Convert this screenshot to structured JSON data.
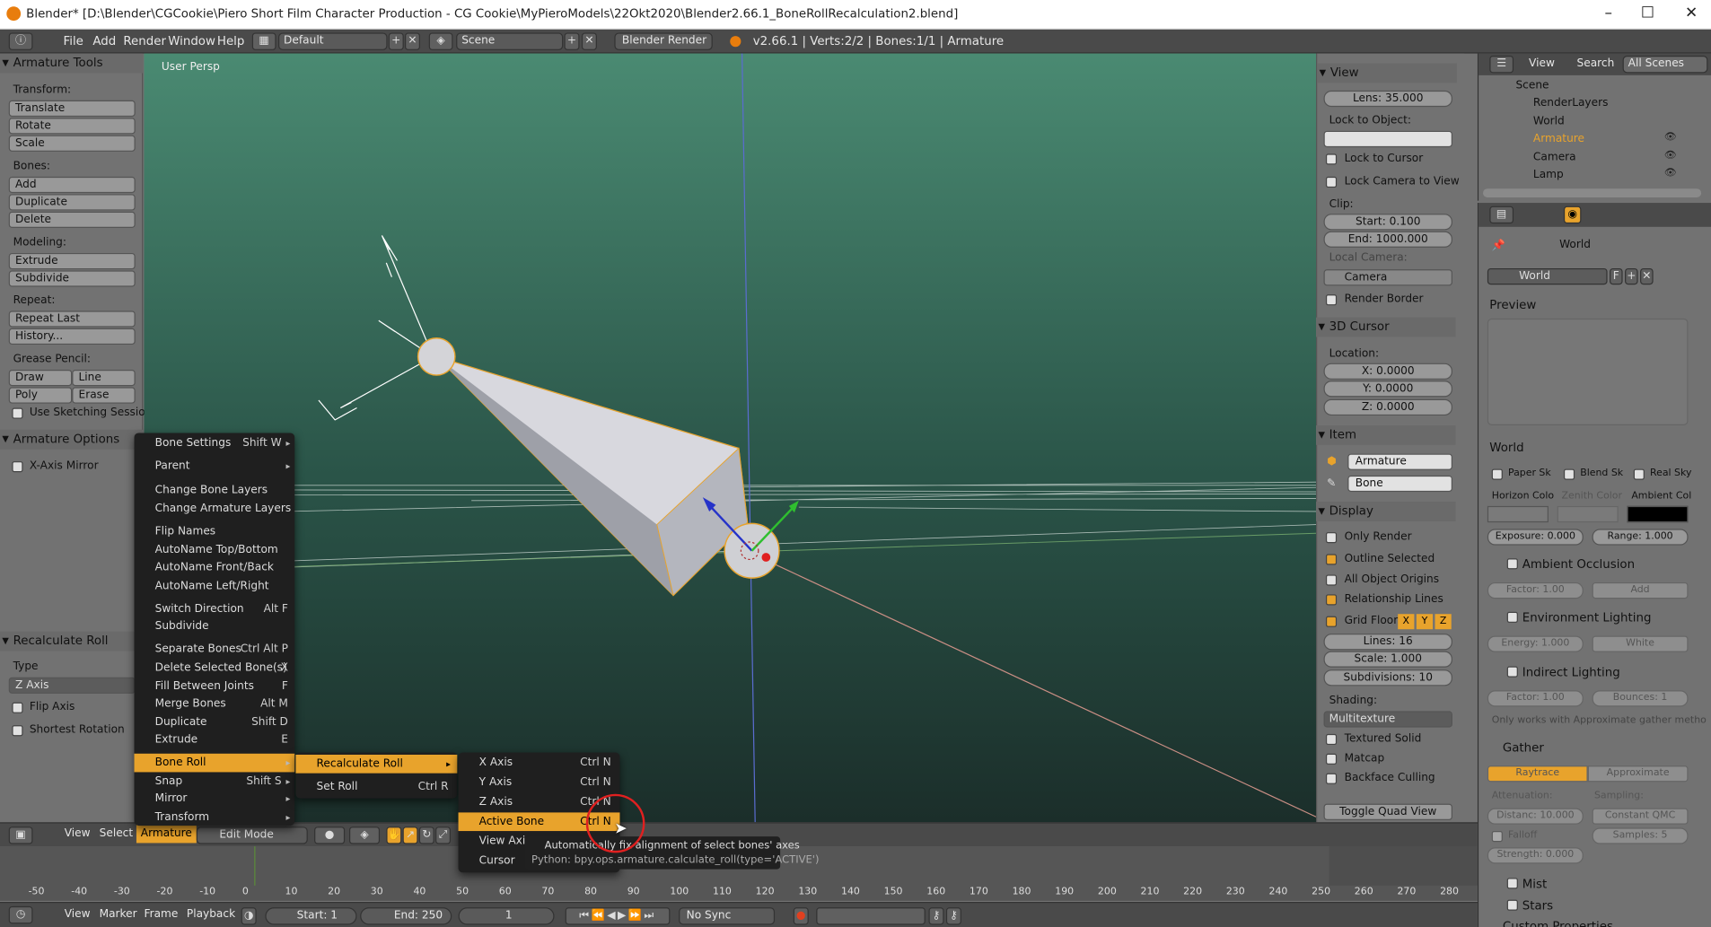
{
  "window": {
    "title": "Blender* [D:\\Blender\\CGCookie\\Piero Short Film Character Production - CG Cookie\\MyPieroModels\\22Okt2020\\Blender2.66.1_BoneRollRecalculation2.blend]",
    "min": "–",
    "max": "☐",
    "close": "✕"
  },
  "menubar": {
    "file": "File",
    "add": "Add",
    "render": "Render",
    "window": "Window",
    "help": "Help",
    "layout": "Default",
    "scene": "Scene",
    "engine": "Blender Render",
    "stats": "v2.66.1 | Verts:2/2 | Bones:1/1 | Armature"
  },
  "toolshelf": {
    "title": "Armature Tools",
    "transform_label": "Transform:",
    "translate": "Translate",
    "rotate": "Rotate",
    "scale": "Scale",
    "bones_label": "Bones:",
    "add": "Add",
    "duplicate": "Duplicate",
    "delete": "Delete",
    "modeling_label": "Modeling:",
    "extrude": "Extrude",
    "subdivide": "Subdivide",
    "repeat_label": "Repeat:",
    "repeat_last": "Repeat Last",
    "history": "History...",
    "grease_label": "Grease Pencil:",
    "draw": "Draw",
    "line": "Line",
    "poly": "Poly",
    "erase": "Erase",
    "sketching": "Use Sketching Sessions",
    "options_title": "Armature Options",
    "xmirror": "X-Axis Mirror",
    "recalc_title": "Recalculate Roll",
    "type_label": "Type",
    "type_value": "Z Axis",
    "flip_axis": "Flip Axis",
    "shortest_rotation": "Shortest Rotation"
  },
  "viewport": {
    "label": "User Persp"
  },
  "npanel": {
    "view_title": "View",
    "lens": "Lens: 35.000",
    "lock_object": "Lock to Object:",
    "lock_cursor": "Lock to Cursor",
    "lock_camera": "Lock Camera to View",
    "clip": "Clip:",
    "clip_start": "Start: 0.100",
    "clip_end": "End: 1000.000",
    "local_camera": "Local Camera:",
    "camera": "Camera",
    "render_border": "Render Border",
    "cursor_title": "3D Cursor",
    "location": "Location:",
    "x": "X: 0.0000",
    "y": "Y: 0.0000",
    "z": "Z: 0.0000",
    "item_title": "Item",
    "item_name": "Armature",
    "bone_name": "Bone",
    "display_title": "Display",
    "only_render": "Only Render",
    "outline_selected": "Outline Selected",
    "all_origins": "All Object Origins",
    "relationship_lines": "Relationship Lines",
    "grid_floor": "Grid Floor",
    "gx": "X",
    "gy": "Y",
    "gz": "Z",
    "lines": "Lines: 16",
    "grid_scale": "Scale: 1.000",
    "subdivisions": "Subdivisions: 10",
    "shading": "Shading:",
    "shading_mode": "Multitexture",
    "textured_solid": "Textured Solid",
    "matcap": "Matcap",
    "backface": "Backface Culling",
    "toggle_quad": "Toggle Quad View"
  },
  "outliner": {
    "view": "View",
    "search": "Search",
    "all_scenes": "All Scenes",
    "items": [
      "Scene",
      "RenderLayers",
      "World",
      "Armature",
      "Camera",
      "Lamp"
    ]
  },
  "properties": {
    "context": "World",
    "world_name": "World",
    "f_btn": "F",
    "preview_title": "Preview",
    "world_title": "World",
    "paper_sky": "Paper Sk",
    "blend_sky": "Blend Sk",
    "real_sky": "Real Sky",
    "horizon": "Horizon Colo",
    "zenith": "Zenith Color",
    "ambient": "Ambient Col",
    "exposure": "Exposure: 0.000",
    "range": "Range: 1.000",
    "ao_title": "Ambient Occlusion",
    "ao_factor": "Factor: 1.00",
    "ao_add": "Add",
    "env_title": "Environment Lighting",
    "env_energy": "Energy: 1.000",
    "env_white": "White",
    "ind_title": "Indirect Lighting",
    "ind_factor": "Factor: 1.00",
    "ind_bounces": "Bounces: 1",
    "ind_note": "Only works with Approximate gather metho",
    "gather_title": "Gather",
    "raytrace": "Raytrace",
    "approximate": "Approximate",
    "attenuation": "Attenuation:",
    "sampling": "Sampling:",
    "distance": "Distanc: 10.000",
    "qmc": "Constant QMC",
    "falloff": "Falloff",
    "samples": "Samples: 5",
    "strength": "Strength: 0.000",
    "mist": "Mist",
    "stars": "Stars",
    "custom": "Custom Properties"
  },
  "view3d_header": {
    "view": "View",
    "select": "Select",
    "armature": "Armature",
    "mode": "Edit Mode"
  },
  "timeline": {
    "ticks": [
      "-50",
      "-40",
      "-30",
      "-20",
      "-10",
      "0",
      "10",
      "20",
      "30",
      "40",
      "50",
      "60",
      "70",
      "80",
      "90",
      "100",
      "110",
      "120",
      "130",
      "140",
      "150",
      "160",
      "170",
      "180",
      "190",
      "200",
      "210",
      "220",
      "230",
      "240",
      "250",
      "260",
      "270",
      "280"
    ],
    "view": "View",
    "marker": "Marker",
    "frame": "Frame",
    "playback": "Playback",
    "start": "Start: 1",
    "end": "End: 250",
    "current": "1",
    "sync": "No Sync"
  },
  "armature_menu": [
    {
      "label": "Bone Settings",
      "shortcut": "Shift W",
      "sub": true
    },
    {
      "label": "Parent",
      "shortcut": "",
      "sub": true
    },
    {
      "label": "Change Bone Layers",
      "shortcut": ""
    },
    {
      "label": "Change Armature Layers",
      "shortcut": ""
    },
    {
      "label": "Flip Names",
      "shortcut": ""
    },
    {
      "label": "AutoName Top/Bottom",
      "shortcut": ""
    },
    {
      "label": "AutoName Front/Back",
      "shortcut": ""
    },
    {
      "label": "AutoName Left/Right",
      "shortcut": ""
    },
    {
      "label": "Switch Direction",
      "shortcut": "Alt F"
    },
    {
      "label": "Subdivide",
      "shortcut": ""
    },
    {
      "label": "Separate Bones",
      "shortcut": "Ctrl Alt P"
    },
    {
      "label": "Delete Selected Bone(s)",
      "shortcut": "X"
    },
    {
      "label": "Fill Between Joints",
      "shortcut": "F"
    },
    {
      "label": "Merge Bones",
      "shortcut": "Alt M"
    },
    {
      "label": "Duplicate",
      "shortcut": "Shift D"
    },
    {
      "label": "Extrude",
      "shortcut": "E"
    },
    {
      "label": "Bone Roll",
      "shortcut": "",
      "sub": true
    },
    {
      "label": "Snap",
      "shortcut": "Shift S",
      "sub": true
    },
    {
      "label": "Mirror",
      "shortcut": "",
      "sub": true
    },
    {
      "label": "Transform",
      "shortcut": "",
      "sub": true
    }
  ],
  "boneroll_menu": [
    {
      "label": "Recalculate Roll",
      "shortcut": ""
    },
    {
      "label": "Set Roll",
      "shortcut": "Ctrl R"
    }
  ],
  "recalc_menu": [
    {
      "label": "X Axis",
      "shortcut": "Ctrl N"
    },
    {
      "label": "Y Axis",
      "shortcut": "Ctrl N"
    },
    {
      "label": "Z Axis",
      "shortcut": "Ctrl N"
    },
    {
      "label": "Active Bone",
      "shortcut": "Ctrl N"
    },
    {
      "label": "View Axis",
      "shortcut": ""
    },
    {
      "label": "Cursor",
      "shortcut": ""
    }
  ],
  "tooltip": {
    "line1": "Automatically fix alignment of select bones' axes",
    "line2": "Python: bpy.ops.armature.calculate_roll(type='ACTIVE')"
  }
}
